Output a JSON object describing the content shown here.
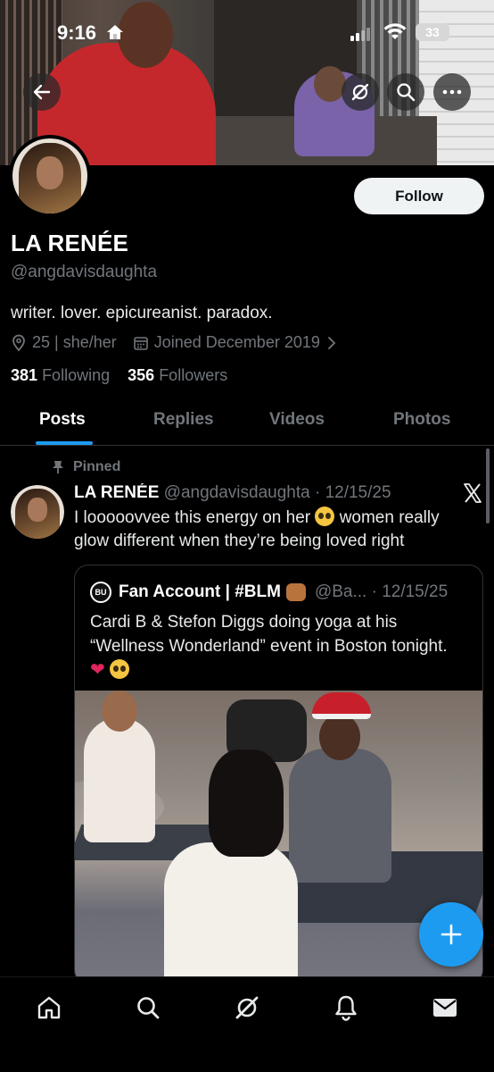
{
  "status_bar": {
    "time": "9:16",
    "battery": "33"
  },
  "header": {
    "follow_label": "Follow"
  },
  "profile": {
    "name": "LA RENÉE",
    "handle": "@angdavisdaughta",
    "bio": "writer. lover. epicureanist. paradox.",
    "location": "25 | she/her",
    "joined": "Joined December 2019",
    "following_count": "381",
    "following_label": "Following",
    "followers_count": "356",
    "followers_label": "Followers"
  },
  "tabs": [
    {
      "label": "Posts",
      "active": true
    },
    {
      "label": "Replies",
      "active": false
    },
    {
      "label": "Videos",
      "active": false
    },
    {
      "label": "Photos",
      "active": false
    }
  ],
  "post": {
    "pinned_label": "Pinned",
    "author": "LA RENÉE",
    "handle_date": "@angdavisdaughta · 12/15/25",
    "text_part1": "I looooovvee this energy on her",
    "text_part2": "women really glow different when they’re being loved right",
    "quote": {
      "badge": "BU",
      "author": "Fan Account | #BLM",
      "handle_date": "@Ba... · 12/15/25",
      "text": "Cardi B & Stefon Diggs doing yoga at his “Wellness Wonderland” event in Boston tonight."
    }
  },
  "colors": {
    "accent": "#1d9bf0",
    "background": "#000000",
    "muted": "#71767b"
  },
  "icons": {
    "back": "arrow-left-icon",
    "grok": "grok-icon",
    "search": "search-icon",
    "more": "more-icon",
    "location": "location-pin-icon",
    "calendar": "calendar-icon",
    "pin": "pin-icon",
    "x_logo": "x-logo-icon",
    "compose": "plus-icon",
    "nav": [
      "home-icon",
      "search-icon",
      "grok-icon",
      "bell-icon",
      "mail-icon"
    ]
  }
}
